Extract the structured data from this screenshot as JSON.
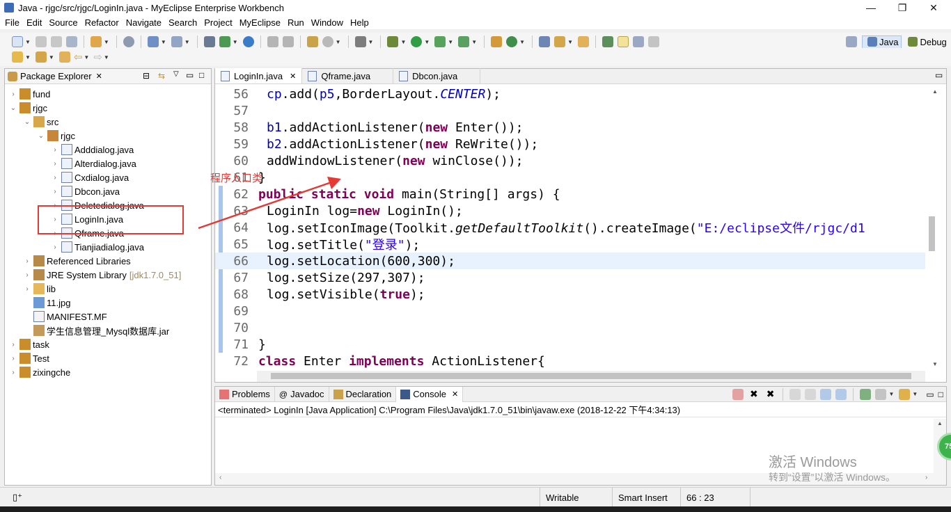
{
  "window": {
    "title": "Java - rjgc/src/rjgc/LoginIn.java - MyEclipse Enterprise Workbench",
    "minimize": "—",
    "restore": "❐",
    "close": "✕"
  },
  "menu": [
    "File",
    "Edit",
    "Source",
    "Refactor",
    "Navigate",
    "Search",
    "Project",
    "MyEclipse",
    "Run",
    "Window",
    "Help"
  ],
  "perspectives": {
    "java": "Java",
    "debug": "Debug"
  },
  "explorer": {
    "title": "Package Explorer",
    "items": [
      {
        "label": "fund",
        "icon": "project-icon",
        "arrow": "›"
      },
      {
        "label": "rjgc",
        "icon": "project-icon",
        "arrow": "⌄"
      },
      {
        "label": "src",
        "icon": "source-folder-icon",
        "arrow": "⌄"
      },
      {
        "label": "rjgc",
        "icon": "package-icon",
        "arrow": "⌄"
      },
      {
        "label": "Adddialog.java",
        "icon": "java-file-icon",
        "arrow": "›"
      },
      {
        "label": "Alterdialog.java",
        "icon": "java-file-icon",
        "arrow": "›"
      },
      {
        "label": "Cxdialog.java",
        "icon": "java-file-icon",
        "arrow": "›"
      },
      {
        "label": "Dbcon.java",
        "icon": "java-file-icon",
        "arrow": "›"
      },
      {
        "label": "Deletedialog.java",
        "icon": "java-file-icon",
        "arrow": "›"
      },
      {
        "label": "LoginIn.java",
        "icon": "java-file-icon",
        "arrow": "›"
      },
      {
        "label": "Qframe.java",
        "icon": "java-file-icon",
        "arrow": "›"
      },
      {
        "label": "Tianjiadialog.java",
        "icon": "java-file-icon",
        "arrow": "›"
      },
      {
        "label": "Referenced Libraries",
        "icon": "library-icon",
        "arrow": "›"
      },
      {
        "label": "JRE System Library",
        "suffix": "[jdk1.7.0_51]",
        "icon": "library-icon",
        "arrow": "›"
      },
      {
        "label": "lib",
        "icon": "folder-icon",
        "arrow": "›"
      },
      {
        "label": "11.jpg",
        "icon": "image-file-icon",
        "arrow": ""
      },
      {
        "label": "MANIFEST.MF",
        "icon": "text-file-icon",
        "arrow": ""
      },
      {
        "label": "学生信息管理_Mysql数据库.jar",
        "icon": "jar-file-icon",
        "arrow": ""
      },
      {
        "label": "task",
        "icon": "project-icon",
        "arrow": "›"
      },
      {
        "label": "Test",
        "icon": "project-icon",
        "arrow": "›"
      },
      {
        "label": "zixingche",
        "icon": "project-icon",
        "arrow": "›"
      }
    ]
  },
  "editor": {
    "tabs": [
      {
        "label": "LoginIn.java",
        "close": "✕",
        "active": true
      },
      {
        "label": "Qframe.java",
        "close": "",
        "active": false
      },
      {
        "label": "Dbcon.java",
        "close": "",
        "active": false
      }
    ],
    "lines": [
      {
        "n": "56",
        "code": "cp.add(p5,BorderLayout.CENTER);"
      },
      {
        "n": "57",
        "code": ""
      },
      {
        "n": "58",
        "code": "b1.addActionListener(new Enter());"
      },
      {
        "n": "59",
        "code": "b2.addActionListener(new ReWrite());"
      },
      {
        "n": "60",
        "code": "addWindowListener(new winClose());"
      },
      {
        "n": "61",
        "code": "}"
      },
      {
        "n": "62",
        "code": "public static void main(String[] args) {"
      },
      {
        "n": "63",
        "code": "LoginIn log=new LoginIn();"
      },
      {
        "n": "64",
        "code": "log.setIconImage(Toolkit.getDefaultToolkit().createImage(\"E:/eclipse文件/rjgc/d1"
      },
      {
        "n": "65",
        "code": "log.setTitle(\"登录\");"
      },
      {
        "n": "66",
        "code": "log.setLocation(600,300);"
      },
      {
        "n": "67",
        "code": "log.setSize(297,307);"
      },
      {
        "n": "68",
        "code": "log.setVisible(true);"
      },
      {
        "n": "69",
        "code": ""
      },
      {
        "n": "70",
        "code": ""
      },
      {
        "n": "71",
        "code": "}"
      },
      {
        "n": "72",
        "code": "class Enter implements ActionListener{"
      }
    ]
  },
  "console": {
    "tabs": [
      "Problems",
      "Javadoc",
      "Declaration",
      "Console"
    ],
    "active": "Console",
    "close": "✕",
    "status": "<terminated> LoginIn [Java Application] C:\\Program Files\\Java\\jdk1.7.0_51\\bin\\javaw.exe (2018-12-22 下午4:34:13)"
  },
  "statusbar": {
    "writable": "Writable",
    "insert_mode": "Smart Insert",
    "position": "66 : 23"
  },
  "annotation": {
    "text": "程序入口类"
  },
  "watermark": {
    "line1": "激活 Windows",
    "line2": "转到“设置”以激活 Windows。"
  },
  "badge": "75",
  "colors": {
    "keyword": "#7f0055",
    "string": "#2a00ff",
    "field": "#0000c0",
    "annotation": "#e53935",
    "current_line": "#e8f2fe"
  }
}
